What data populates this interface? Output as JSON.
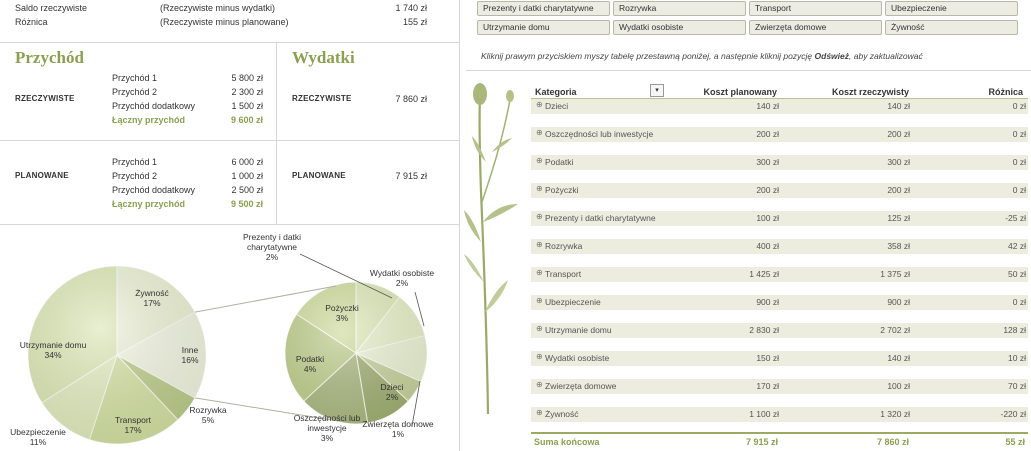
{
  "summary": {
    "rows": [
      {
        "label": "Saldo rzeczywiste",
        "note": "(Rzeczywiste minus wydatki)",
        "value": "1 740 zł"
      },
      {
        "label": "Różnica",
        "note": "(Rzeczywiste minus planowane)",
        "value": "155 zł"
      }
    ]
  },
  "income": {
    "title": "Przychód",
    "actual": {
      "label": "RZECZYWISTE",
      "items": [
        {
          "label": "Przychód 1",
          "value": "5 800 zł"
        },
        {
          "label": "Przychód 2",
          "value": "2 300 zł"
        },
        {
          "label": "Przychód dodatkowy",
          "value": "1 500 zł"
        }
      ],
      "total_label": "Łączny przychód",
      "total_value": "9 600 zł"
    },
    "planned": {
      "label": "PLANOWANE",
      "items": [
        {
          "label": "Przychód 1",
          "value": "6 000 zł"
        },
        {
          "label": "Przychód 2",
          "value": "1 000 zł"
        },
        {
          "label": "Przychód dodatkowy",
          "value": "2 500 zł"
        }
      ],
      "total_label": "Łączny przychód",
      "total_value": "9 500 zł"
    }
  },
  "expenses": {
    "title": "Wydatki",
    "actual": {
      "label": "RZECZYWISTE",
      "value": "7 860 zł"
    },
    "planned": {
      "label": "PLANOWANE",
      "value": "7 915 zł"
    }
  },
  "slicer": {
    "buttons": [
      "Prezenty i datki charytatywne",
      "Rozrywka",
      "Transport",
      "Ubezpieczenie",
      "Utrzymanie domu",
      "Wydatki osobiste",
      "Zwierzęta domowe",
      "Żywność"
    ]
  },
  "instruction": {
    "text_before": "Kliknij prawym przyciskiem myszy tabelę przestawną poniżej, a następnie kliknij pozycję ",
    "bold": "Odśwież",
    "text_after": ", aby zaktualizować"
  },
  "pivot": {
    "headers": {
      "category": "Kategoria",
      "planned": "Koszt planowany",
      "actual": "Koszt rzeczywisty",
      "diff": "Różnica"
    },
    "dropdown_icon": "dropdown-arrow-icon",
    "expand_icon": "expand-circle-icon",
    "rows": [
      {
        "category": "Dzieci",
        "planned": "140 zł",
        "actual": "140 zł",
        "diff": "0 zł"
      },
      {
        "category": "Oszczędności lub inwestycje",
        "planned": "200 zł",
        "actual": "200 zł",
        "diff": "0 zł"
      },
      {
        "category": "Podatki",
        "planned": "300 zł",
        "actual": "300 zł",
        "diff": "0 zł"
      },
      {
        "category": "Pożyczki",
        "planned": "200 zł",
        "actual": "200 zł",
        "diff": "0 zł"
      },
      {
        "category": "Prezenty i datki charytatywne",
        "planned": "100 zł",
        "actual": "125 zł",
        "diff": "-25 zł"
      },
      {
        "category": "Rozrywka",
        "planned": "400 zł",
        "actual": "358 zł",
        "diff": "42 zł"
      },
      {
        "category": "Transport",
        "planned": "1 425 zł",
        "actual": "1 375 zł",
        "diff": "50 zł"
      },
      {
        "category": "Ubezpieczenie",
        "planned": "900 zł",
        "actual": "900 zł",
        "diff": "0 zł"
      },
      {
        "category": "Utrzymanie domu",
        "planned": "2 830 zł",
        "actual": "2 702 zł",
        "diff": "128 zł"
      },
      {
        "category": "Wydatki osobiste",
        "planned": "150 zł",
        "actual": "140 zł",
        "diff": "10 zł"
      },
      {
        "category": "Zwierzęta domowe",
        "planned": "170 zł",
        "actual": "100 zł",
        "diff": "70 zł"
      },
      {
        "category": "Żywność",
        "planned": "1 100 zł",
        "actual": "1 320 zł",
        "diff": "-220 zł"
      }
    ],
    "total": {
      "label": "Suma końcowa",
      "planned": "7 915 zł",
      "actual": "7 860 zł",
      "diff": "55 zł"
    }
  },
  "chart_data": {
    "type": "pie",
    "main_pie": [
      {
        "label": "Żywność",
        "value": 17,
        "display": "17%",
        "color": "#eef1dc"
      },
      {
        "label": "Inne",
        "value": 16,
        "display": "16%",
        "color": "#f4f5ea"
      },
      {
        "label": "Rozrywka",
        "value": 5,
        "display": "5%",
        "color": "#b9c98c"
      },
      {
        "label": "Transport",
        "value": 17,
        "display": "17%",
        "color": "#d3dfa6"
      },
      {
        "label": "Ubezpieczenie",
        "value": 11,
        "display": "11%",
        "color": "#e2ebc4"
      },
      {
        "label": "Utrzymanie domu",
        "value": 34,
        "display": "34%",
        "color": "#dde6b9"
      }
    ],
    "secondary_pie": [
      {
        "label": "Prezenty i datki charytatywne",
        "value": 2,
        "display": "2%",
        "color": "#dfe8bd"
      },
      {
        "label": "Wydatki osobiste",
        "value": 2,
        "display": "2%",
        "color": "#e9efcf"
      },
      {
        "label": "",
        "value": 2,
        "display": "",
        "color": "#eef2dc"
      },
      {
        "label": "Zwierzęta domowe",
        "value": 1,
        "display": "1%",
        "color": "#c5cfa0"
      },
      {
        "label": "Dzieci",
        "value": 2,
        "display": "2%",
        "color": "#9ba973"
      },
      {
        "label": "Oszczędności lub inwestycje",
        "value": 3,
        "display": "3%",
        "color": "#a7b482"
      },
      {
        "label": "Podatki",
        "value": 4,
        "display": "4%",
        "color": "#bccb8d"
      },
      {
        "label": "Pożyczki",
        "value": 3,
        "display": "3%",
        "color": "#cfdb9f"
      }
    ]
  },
  "decoration": {
    "plant": "plant-illustration"
  }
}
